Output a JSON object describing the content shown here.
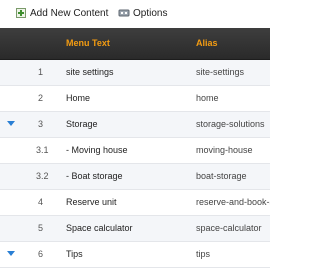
{
  "toolbar": {
    "add_label": "Add New Content",
    "options_label": "Options"
  },
  "grid": {
    "headers": {
      "menu_text": "Menu Text",
      "alias": "Alias"
    },
    "rows": [
      {
        "num": "1",
        "text": "site settings",
        "alias": "site-settings",
        "expanded": false
      },
      {
        "num": "2",
        "text": "Home",
        "alias": "home",
        "expanded": false
      },
      {
        "num": "3",
        "text": "Storage",
        "alias": "storage-solutions",
        "expanded": true
      },
      {
        "num": "3.1",
        "text": "-  Moving house",
        "alias": "moving-house",
        "expanded": false
      },
      {
        "num": "3.2",
        "text": "-  Boat storage",
        "alias": "boat-storage",
        "expanded": false
      },
      {
        "num": "4",
        "text": "Reserve unit",
        "alias": "reserve-and-book-st",
        "expanded": false
      },
      {
        "num": "5",
        "text": "Space calculator",
        "alias": "space-calculator",
        "expanded": false
      },
      {
        "num": "6",
        "text": "Tips",
        "alias": "tips",
        "expanded": true
      }
    ]
  },
  "colors": {
    "header_bg": "#333333",
    "header_text": "#f39c12",
    "toggle": "#2a7fd4"
  }
}
